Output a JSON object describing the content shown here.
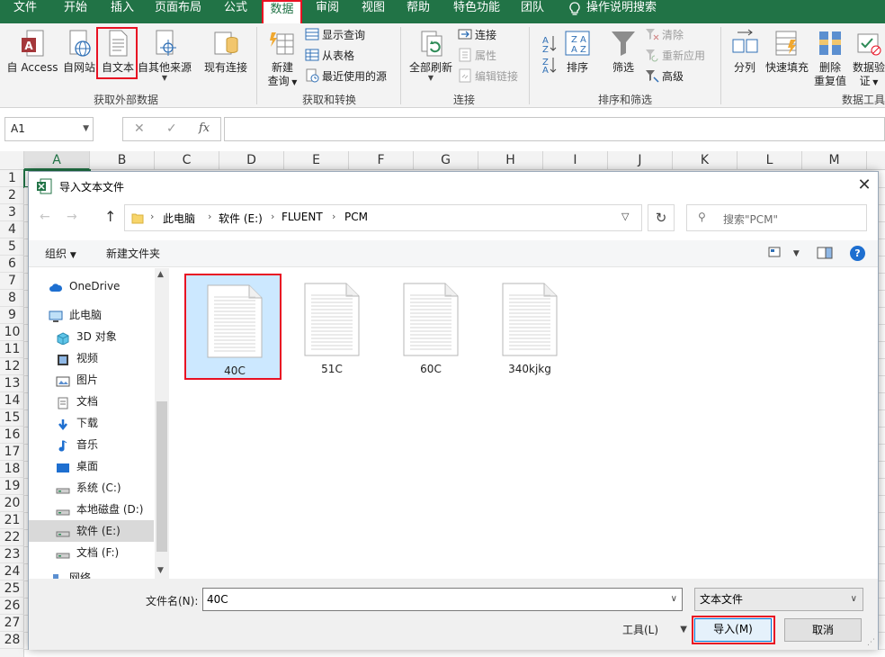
{
  "menu": {
    "tabs": [
      "文件",
      "开始",
      "插入",
      "页面布局",
      "公式",
      "数据",
      "审阅",
      "视图",
      "帮助",
      "特色功能",
      "团队"
    ],
    "active_tab": "数据",
    "tell_me": "操作说明搜索"
  },
  "ribbon": {
    "get_external": {
      "access": "自 Access",
      "web": "自网站",
      "text": "自文本",
      "other": "自其他来源",
      "existing": "现有连接",
      "label": "获取外部数据"
    },
    "get_transform": {
      "new_query_1": "新建",
      "new_query_2": "查询",
      "show_queries": "显示查询",
      "from_table": "从表格",
      "recent_sources": "最近使用的源",
      "label": "获取和转换"
    },
    "connections": {
      "refresh_all": "全部刷新",
      "connections": "连接",
      "properties": "属性",
      "edit_links": "编辑链接",
      "label": "连接"
    },
    "sort_filter": {
      "sort": "排序",
      "filter": "筛选",
      "clear": "清除",
      "reapply": "重新应用",
      "advanced": "高级",
      "label": "排序和筛选"
    },
    "data_tools": {
      "text_to_columns": "分列",
      "flash_fill": "快速填充",
      "remove_dup_1": "删除",
      "remove_dup_2": "重复值",
      "validation_1": "数据验",
      "validation_2": "证",
      "label": "数据工具"
    }
  },
  "formula_bar": {
    "name_box": "A1",
    "fx": "fx",
    "formula": ""
  },
  "sheet": {
    "columns": [
      "A",
      "B",
      "C",
      "D",
      "E",
      "F",
      "G",
      "H",
      "I",
      "J",
      "K",
      "L",
      "M"
    ],
    "rows": [
      "1",
      "2",
      "3",
      "4",
      "5",
      "6",
      "7",
      "8",
      "9",
      "10",
      "11",
      "12",
      "13",
      "14",
      "15",
      "16",
      "17",
      "18",
      "19",
      "20",
      "21",
      "22",
      "23",
      "24",
      "25",
      "26",
      "27",
      "28"
    ]
  },
  "dialog": {
    "title": "导入文本文件",
    "path": [
      "此电脑",
      "软件 (E:)",
      "FLUENT",
      "PCM"
    ],
    "search_placeholder": "搜索\"PCM\"",
    "organize": "组织",
    "new_folder": "新建文件夹",
    "nav": [
      {
        "label": "OneDrive",
        "icon": "cloud-icon"
      },
      {
        "label": "此电脑",
        "icon": "computer-icon"
      },
      {
        "label": "3D 对象",
        "icon": "cube-icon"
      },
      {
        "label": "视频",
        "icon": "video-icon"
      },
      {
        "label": "图片",
        "icon": "picture-icon"
      },
      {
        "label": "文档",
        "icon": "document-icon"
      },
      {
        "label": "下载",
        "icon": "download-icon"
      },
      {
        "label": "音乐",
        "icon": "music-icon"
      },
      {
        "label": "桌面",
        "icon": "desktop-icon"
      },
      {
        "label": "系统 (C:)",
        "icon": "drive-icon"
      },
      {
        "label": "本地磁盘 (D:)",
        "icon": "drive-icon"
      },
      {
        "label": "软件 (E:)",
        "icon": "drive-icon"
      },
      {
        "label": "文档 (F:)",
        "icon": "drive-icon"
      },
      {
        "label": "网络",
        "icon": "network-icon"
      }
    ],
    "selected_nav": "软件 (E:)",
    "files": [
      "40C",
      "51C",
      "60C",
      "340kjkg"
    ],
    "selected_file": "40C",
    "filename_label": "文件名(N):",
    "filename_value": "40C",
    "filetype": "文本文件",
    "tools": "工具(L)",
    "import": "导入(M)",
    "cancel": "取消"
  },
  "colors": {
    "excel_green": "#217346",
    "highlight_red": "#e81123",
    "selection_blue": "#cce8ff"
  }
}
